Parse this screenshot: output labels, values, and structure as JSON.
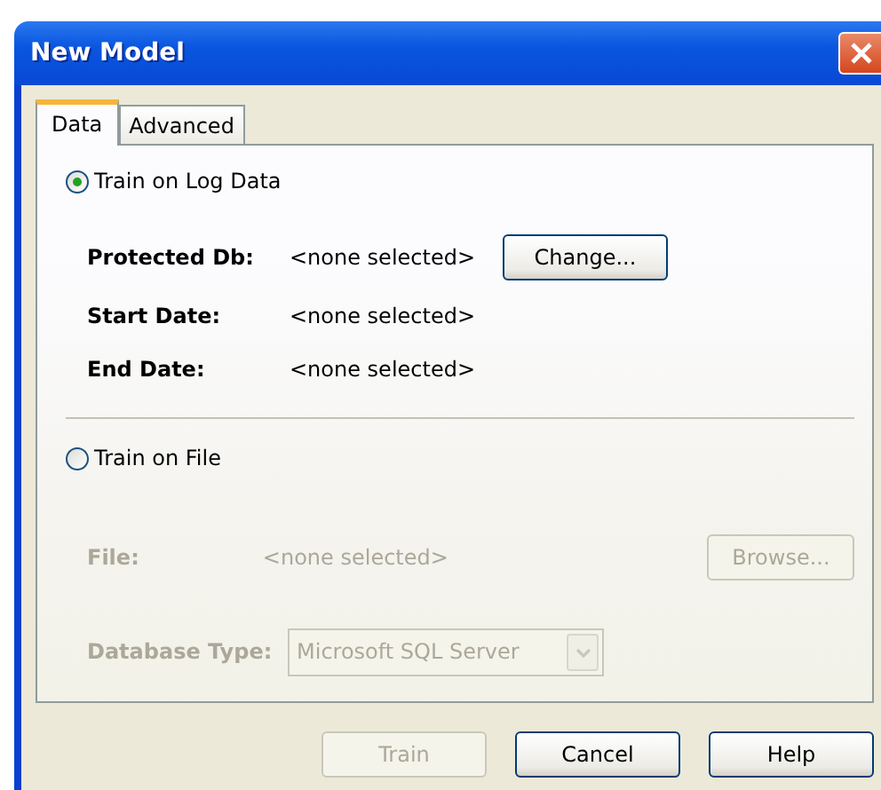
{
  "window": {
    "title": "New Model"
  },
  "tabs": [
    {
      "label": "Data",
      "selected": true
    },
    {
      "label": "Advanced",
      "selected": false
    }
  ],
  "sources": [
    {
      "label": "Train on Log Data",
      "selected": true,
      "fields": [
        {
          "kind": "text",
          "label": "Protected Db:",
          "value": "<none selected>",
          "button": "Change...",
          "disabled": false
        },
        {
          "kind": "text",
          "label": "Start Date:",
          "value": "<none selected>",
          "disabled": false
        },
        {
          "kind": "text",
          "label": "End Date:",
          "value": "<none selected>",
          "disabled": false
        }
      ]
    },
    {
      "label": "Train on File",
      "selected": false,
      "fields": [
        {
          "kind": "text",
          "label": "File:",
          "value": "<none selected>",
          "button": "Browse...",
          "disabled": true
        },
        {
          "kind": "select",
          "label": "Database Type:",
          "value": "Microsoft SQL Server",
          "disabled": true
        }
      ]
    }
  ],
  "buttons": [
    {
      "label": "Train",
      "disabled": true
    },
    {
      "label": "Cancel",
      "disabled": false
    },
    {
      "label": "Help",
      "disabled": false
    }
  ]
}
